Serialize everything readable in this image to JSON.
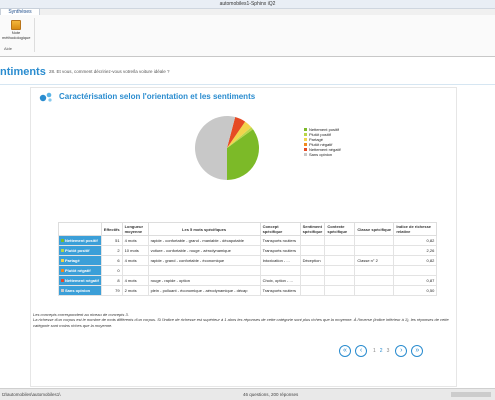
{
  "window": {
    "title": "automobiles1-Sphinx iQ2"
  },
  "ribbon": {
    "tab": "Synthèses",
    "button_label": "Note méthodologique",
    "group_label": "Aide"
  },
  "page": {
    "section_title": "ntiments",
    "question": "28. Et vous, comment décririez-vous votre/la voiture idéale ?"
  },
  "card": {
    "title": "Caractérisation selon l'orientation et les sentiments"
  },
  "chart_data": {
    "type": "pie",
    "categories": [
      "Nettement positif",
      "Plutôt positif",
      "Partagé",
      "Plutôt négatif",
      "Nettement négatif",
      "Sans opinion"
    ],
    "values": [
      51,
      2,
      6,
      0,
      8,
      79
    ],
    "colors": [
      "#7cba28",
      "#b9d649",
      "#f2d44c",
      "#f08a1e",
      "#e64a24",
      "#c8c8c8"
    ]
  },
  "table": {
    "headers": [
      "",
      "Effectifs",
      "Longueur moyenne",
      "Les 5 mots spécifiques",
      "Concept spécifique",
      "Sentiment spécifique",
      "Contexte spécifique",
      "Classe spécifique",
      "Indice de richesse relative"
    ],
    "rows": [
      {
        "label": "Nettement positif",
        "color": "#7cba28",
        "eff": "51",
        "lon": "4 mots",
        "mots": "rapide - confortable - grand - maniable - décapotable",
        "con": "Transports routiers",
        "sen": "",
        "ctx": "",
        "cla": "",
        "ind": "0,82"
      },
      {
        "label": "Plutôt positif",
        "color": "#b9d649",
        "eff": "2",
        "lon": "10 mots",
        "mots": "voiture - confortable - rouge - aérodynamique",
        "con": "Transports routiers",
        "sen": "",
        "ctx": "",
        "cla": "",
        "ind": "2,26"
      },
      {
        "label": "Partagé",
        "color": "#f2d44c",
        "eff": "6",
        "lon": "4 mots",
        "mots": "rapide - grand - confortable - économique",
        "con": "Intoxication - ...",
        "sen": "Déception",
        "ctx": "",
        "cla": "Classe n° 2",
        "ind": "0,82"
      },
      {
        "label": "Plutôt négatif",
        "color": "#f08a1e",
        "eff": "0",
        "lon": "",
        "mots": "",
        "con": "",
        "sen": "",
        "ctx": "",
        "cla": "",
        "ind": ""
      },
      {
        "label": "Nettement négatif",
        "color": "#e64a24",
        "eff": "8",
        "lon": "4 mots",
        "mots": "rouge - rapide - option",
        "con": "Choix, option - ...",
        "sen": "",
        "ctx": "",
        "cla": "",
        "ind": "0,87"
      },
      {
        "label": "Sans opinion",
        "color": "#c8c8c8",
        "eff": "79",
        "lon": "2 mots",
        "mots": "plein - polluant - économique - aérodynamique - décap",
        "con": "Transports routiers",
        "sen": "",
        "ctx": "",
        "cla": "",
        "ind": "0,50"
      }
    ]
  },
  "notes": {
    "line1": "Les concepts correspondent au niveau de concepts 3.",
    "line2": "La richesse d'un corpus est le nombre de mots différents d'un corpus. Si l'indice de richesse est supérieur à 1 alors les réponses de cette catégorie sont plus riches que la moyenne. À l'inverse (indice inférieur à 1), les réponses de cette catégorie sont moins riches que la moyenne."
  },
  "pager": {
    "pages": [
      "1",
      "2",
      "3"
    ],
    "current": "2"
  },
  "status": {
    "file": "t2\\automobiles\\automobiles1\\",
    "summary": "46 questions, 200 réponses"
  }
}
